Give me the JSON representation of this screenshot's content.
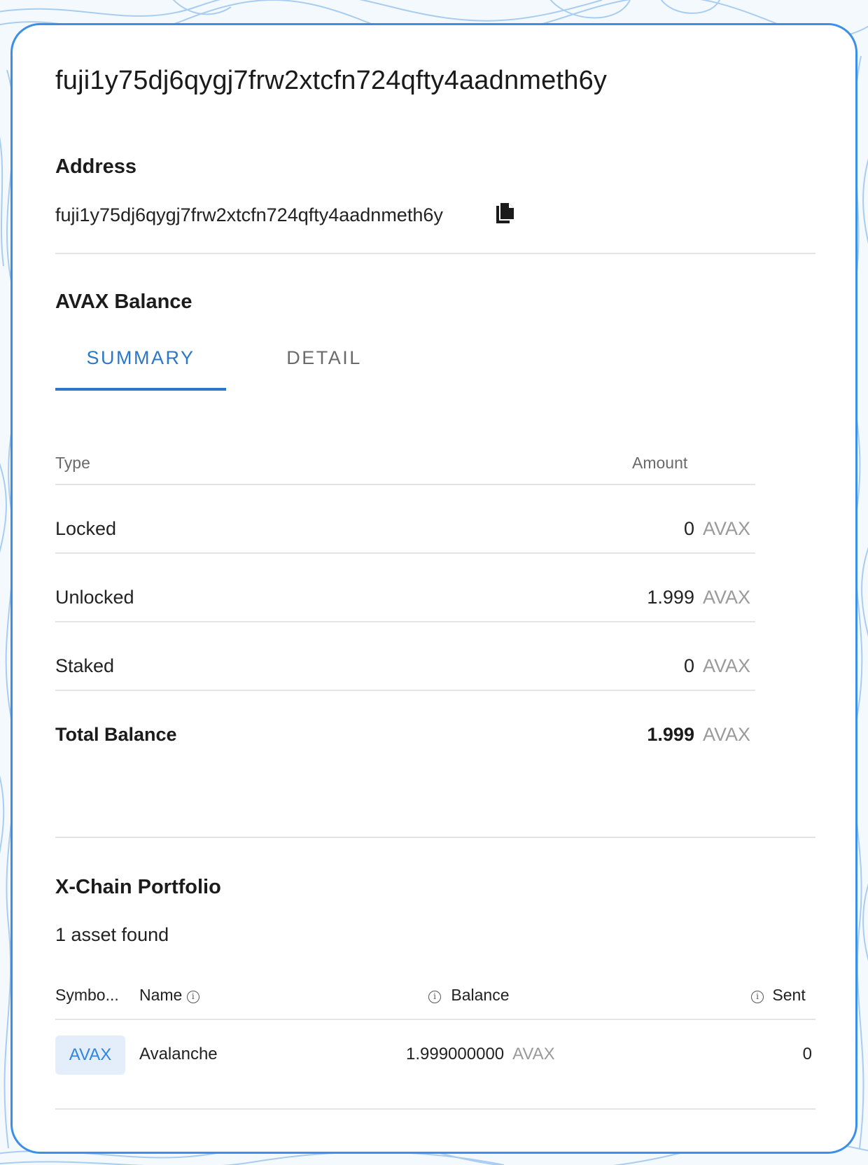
{
  "page": {
    "title": "fuji1y75dj6qygj7frw2xtcfn724qfty4aadnmeth6y"
  },
  "address": {
    "heading": "Address",
    "value": "fuji1y75dj6qygj7frw2xtcfn724qfty4aadnmeth6y",
    "copy_icon": "copy-icon"
  },
  "avax_balance": {
    "heading": "AVAX Balance",
    "tabs": [
      {
        "label": "SUMMARY",
        "active": true
      },
      {
        "label": "DETAIL",
        "active": false
      }
    ],
    "columns": {
      "type": "Type",
      "amount": "Amount"
    },
    "rows": [
      {
        "label": "Locked",
        "amount": "0",
        "unit": "AVAX"
      },
      {
        "label": "Unlocked",
        "amount": "1.999",
        "unit": "AVAX"
      },
      {
        "label": "Staked",
        "amount": "0",
        "unit": "AVAX"
      }
    ],
    "total": {
      "label": "Total Balance",
      "amount": "1.999",
      "unit": "AVAX"
    }
  },
  "portfolio": {
    "heading": "X-Chain Portfolio",
    "asset_count": "1 asset found",
    "columns": {
      "symbol": "Symbo...",
      "name": "Name",
      "balance": "Balance",
      "sent": "Sent"
    },
    "info_icon": "info-icon",
    "rows": [
      {
        "symbol": "AVAX",
        "name": "Avalanche",
        "balance": "1.999000000",
        "unit": "AVAX",
        "sent": "0"
      }
    ]
  },
  "colors": {
    "accent": "#2b78c9",
    "card_border": "#3b8fe6",
    "chip_bg": "#e4eefb",
    "muted": "#9a9a9a"
  }
}
